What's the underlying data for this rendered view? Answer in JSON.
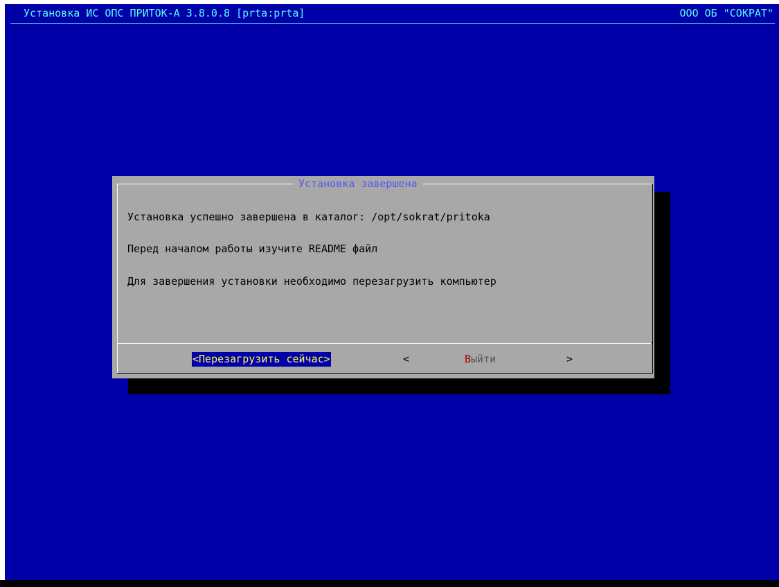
{
  "header": {
    "title": "Установка ИС ОПС ПРИТОК-А 3.8.0.8 [prta:prta]",
    "vendor": "ООО ОБ \"СОКРАТ\""
  },
  "dialog": {
    "title": "Установка завершена",
    "lines": [
      "Установка успешно завершена в каталог: /opt/sokrat/pritoka",
      "Перед началом работы изучите README файл",
      "Для завершения установки необходимо перезагрузить компьютер"
    ],
    "buttons": {
      "reboot": "<Перезагрузить сейчас>",
      "exit_open": "<",
      "exit_hotkey": "В",
      "exit_rest": "ыйти",
      "exit_close": ">"
    }
  },
  "colors": {
    "screen_background": "#0000a8",
    "dialog_background": "#a8a8a8",
    "header_text": "#54fcfc",
    "dialog_title": "#5454fc",
    "focused_button_text": "#fcfc54",
    "hotkey": "#a80000"
  }
}
